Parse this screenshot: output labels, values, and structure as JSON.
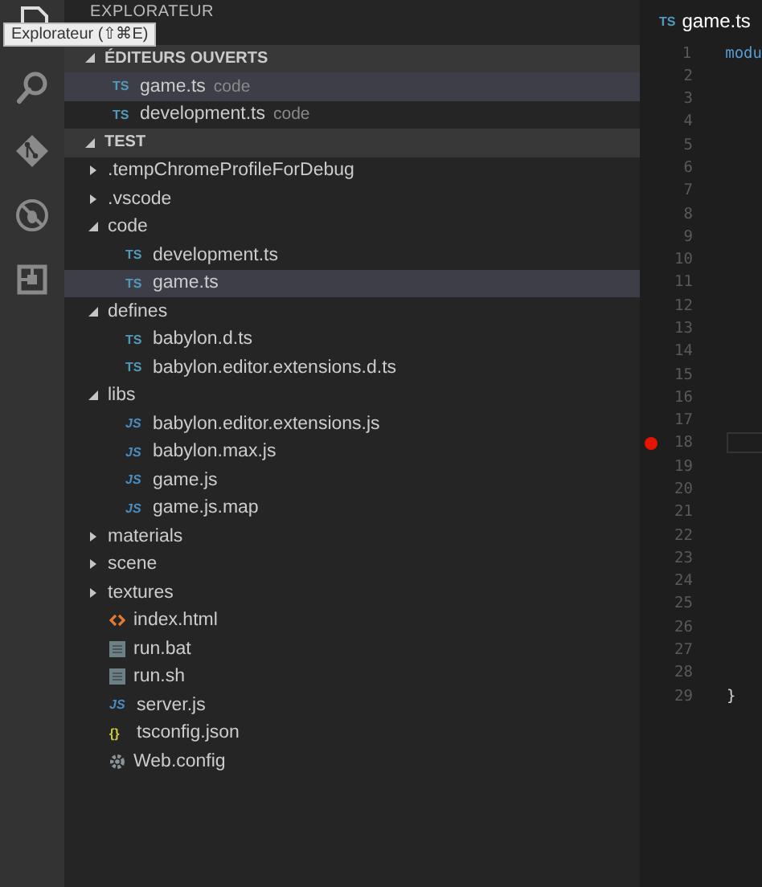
{
  "activity_bar": {
    "items": [
      {
        "kind": "explorer",
        "selected": true
      },
      {
        "kind": "search",
        "selected": false
      },
      {
        "kind": "git",
        "selected": false
      },
      {
        "kind": "debug",
        "selected": false
      },
      {
        "kind": "extensions",
        "selected": false
      }
    ],
    "tooltip": "Explorateur (⇧⌘E)"
  },
  "sidebar": {
    "title": "EXPLORATEUR",
    "sections": [
      {
        "title": "ÉDITEURS OUVERTS",
        "expanded": true,
        "items": [
          {
            "name": "game.ts",
            "kind": "ts",
            "badge": "TS",
            "folder": "code",
            "selected": true
          },
          {
            "name": "development.ts",
            "kind": "ts",
            "badge": "TS",
            "folder": "code",
            "selected": false
          }
        ]
      },
      {
        "title": "TEST",
        "expanded": true,
        "items": [
          {
            "name": ".tempChromeProfileForDebug",
            "kind": "folder",
            "expanded": false,
            "selected": false
          },
          {
            "name": ".vscode",
            "kind": "folder",
            "expanded": false,
            "selected": false
          },
          {
            "name": "code",
            "kind": "folder",
            "expanded": true,
            "selected": false,
            "children": [
              {
                "name": "development.ts",
                "kind": "ts",
                "badge": "TS",
                "selected": false
              },
              {
                "name": "game.ts",
                "kind": "ts",
                "badge": "TS",
                "selected": true
              }
            ]
          },
          {
            "name": "defines",
            "kind": "folder",
            "expanded": true,
            "selected": false,
            "children": [
              {
                "name": "babylon.d.ts",
                "kind": "ts",
                "badge": "TS",
                "selected": false
              },
              {
                "name": "babylon.editor.extensions.d.ts",
                "kind": "ts",
                "badge": "TS",
                "selected": false
              }
            ]
          },
          {
            "name": "libs",
            "kind": "folder",
            "expanded": true,
            "selected": false,
            "children": [
              {
                "name": "babylon.editor.extensions.js",
                "kind": "js",
                "badge": "JS",
                "selected": false
              },
              {
                "name": "babylon.max.js",
                "kind": "js",
                "badge": "JS",
                "selected": false
              },
              {
                "name": "game.js",
                "kind": "js",
                "badge": "JS",
                "selected": false
              },
              {
                "name": "game.js.map",
                "kind": "js",
                "badge": "JS",
                "selected": false
              }
            ]
          },
          {
            "name": "materials",
            "kind": "folder",
            "expanded": false,
            "selected": false
          },
          {
            "name": "scene",
            "kind": "folder",
            "expanded": false,
            "selected": false
          },
          {
            "name": "textures",
            "kind": "folder",
            "expanded": false,
            "selected": false
          },
          {
            "name": "index.html",
            "kind": "html",
            "selected": false
          },
          {
            "name": "run.bat",
            "kind": "file",
            "selected": false
          },
          {
            "name": "run.sh",
            "kind": "file",
            "selected": false
          },
          {
            "name": "server.js",
            "kind": "js",
            "badge": "JS",
            "selected": false
          },
          {
            "name": "tsconfig.json",
            "kind": "json",
            "badge": "{}",
            "selected": false
          },
          {
            "name": "Web.config",
            "kind": "config",
            "selected": false
          }
        ]
      }
    ]
  },
  "editor": {
    "tab": {
      "name": "game.ts",
      "badge": "TS"
    },
    "lines": [
      {
        "number": "1",
        "text": "modu"
      },
      {
        "number": "2"
      },
      {
        "number": "3"
      },
      {
        "number": "4"
      },
      {
        "number": "5"
      },
      {
        "number": "6"
      },
      {
        "number": "7"
      },
      {
        "number": "8"
      },
      {
        "number": "9"
      },
      {
        "number": "10"
      },
      {
        "number": "11"
      },
      {
        "number": "12"
      },
      {
        "number": "13"
      },
      {
        "number": "14"
      },
      {
        "number": "15"
      },
      {
        "number": "16"
      },
      {
        "number": "17"
      },
      {
        "number": "18",
        "breakpoint": true,
        "current": true
      },
      {
        "number": "19"
      },
      {
        "number": "20"
      },
      {
        "number": "21"
      },
      {
        "number": "22"
      },
      {
        "number": "23"
      },
      {
        "number": "24"
      },
      {
        "number": "25"
      },
      {
        "number": "26"
      },
      {
        "number": "27"
      },
      {
        "number": "28"
      },
      {
        "number": "29",
        "text": "}"
      }
    ]
  }
}
